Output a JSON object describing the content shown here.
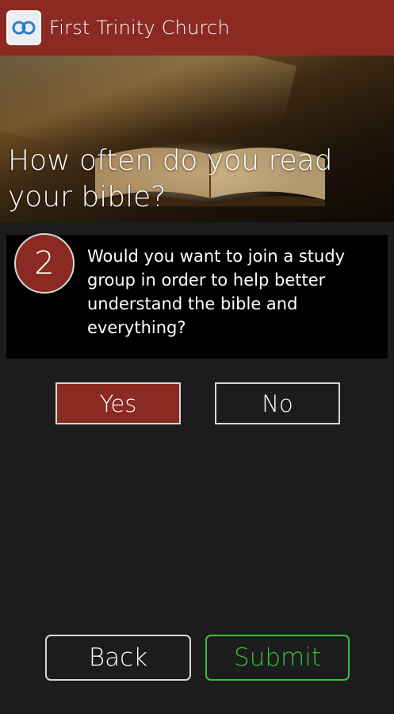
{
  "app": {
    "title": "First Trinity Church",
    "icon": "church-logo-icon"
  },
  "hero": {
    "question": "How often do you read your bible?"
  },
  "question": {
    "number": "2",
    "text": "Would you want to join a study group in order to help better understand the bible and everything?"
  },
  "answers": {
    "yes_label": "Yes",
    "no_label": "No",
    "selected": "Yes"
  },
  "footer": {
    "back_label": "Back",
    "submit_label": "Submit"
  },
  "colors": {
    "brand": "#8a2a22",
    "background": "#1c1c1c",
    "submit": "#3bbf3b"
  }
}
